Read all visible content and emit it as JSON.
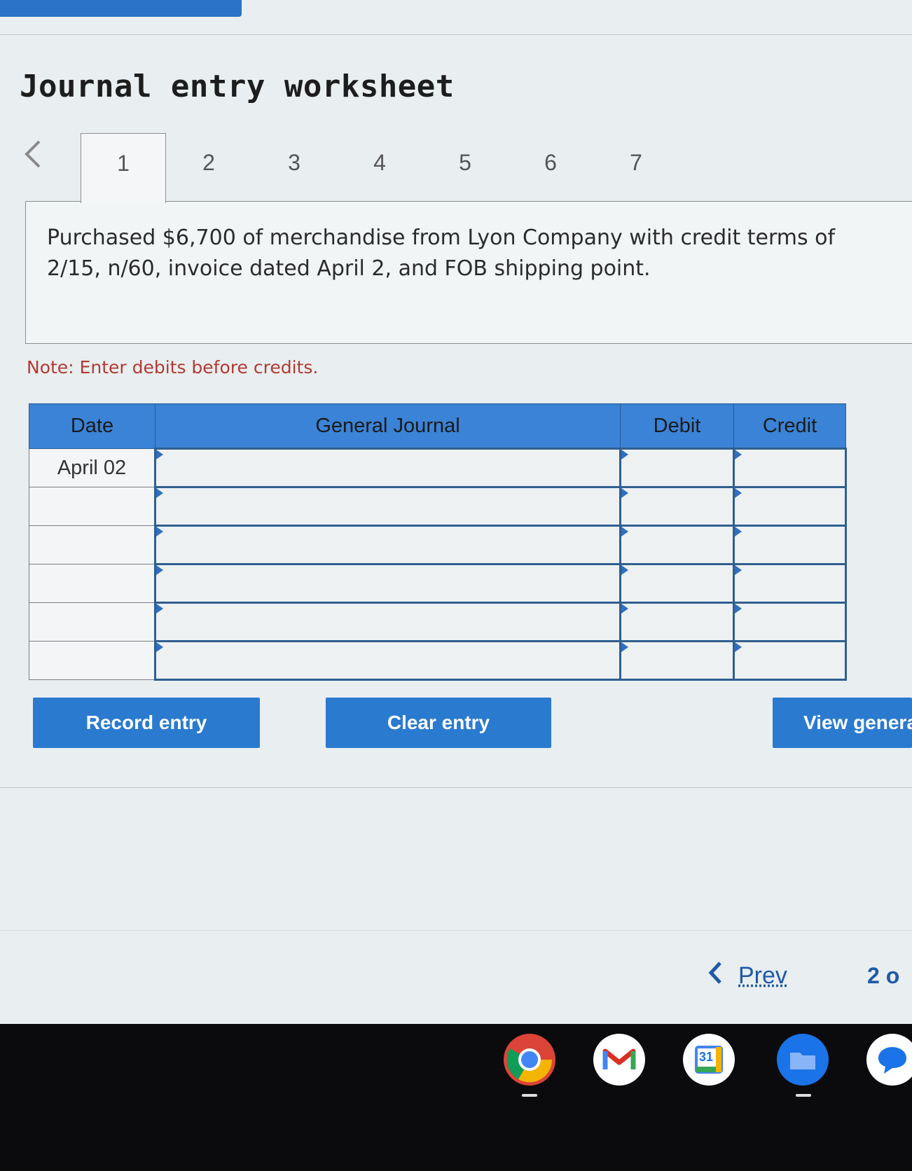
{
  "page": {
    "title": "Journal entry worksheet"
  },
  "tabs": {
    "items": [
      "1",
      "2",
      "3",
      "4",
      "5",
      "6",
      "7"
    ],
    "active_index": 0
  },
  "prompt": {
    "text": "Purchased $6,700 of merchandise from Lyon Company with credit terms of 2/15, n/60, invoice dated April 2, and FOB shipping point."
  },
  "note": "Note: Enter debits before credits.",
  "journal": {
    "headers": [
      "Date",
      "General Journal",
      "Debit",
      "Credit"
    ],
    "rows": [
      {
        "date": "April 02",
        "account": "",
        "debit": "",
        "credit": ""
      },
      {
        "date": "",
        "account": "",
        "debit": "",
        "credit": ""
      },
      {
        "date": "",
        "account": "",
        "debit": "",
        "credit": ""
      },
      {
        "date": "",
        "account": "",
        "debit": "",
        "credit": ""
      },
      {
        "date": "",
        "account": "",
        "debit": "",
        "credit": ""
      },
      {
        "date": "",
        "account": "",
        "debit": "",
        "credit": ""
      }
    ]
  },
  "buttons": {
    "record": "Record entry",
    "clear": "Clear entry",
    "view": "View genera"
  },
  "pager": {
    "prev_label": "Prev",
    "page_text": "2 o"
  },
  "shelf": {
    "icons": [
      "chrome-icon",
      "gmail-icon",
      "calendar-icon",
      "files-icon",
      "messages-icon"
    ],
    "calendar_day": "31"
  },
  "colors": {
    "accent": "#2a7ad0",
    "header_blue": "#3a83d6",
    "note_red": "#b23b33",
    "link_blue": "#1f5aa6"
  }
}
